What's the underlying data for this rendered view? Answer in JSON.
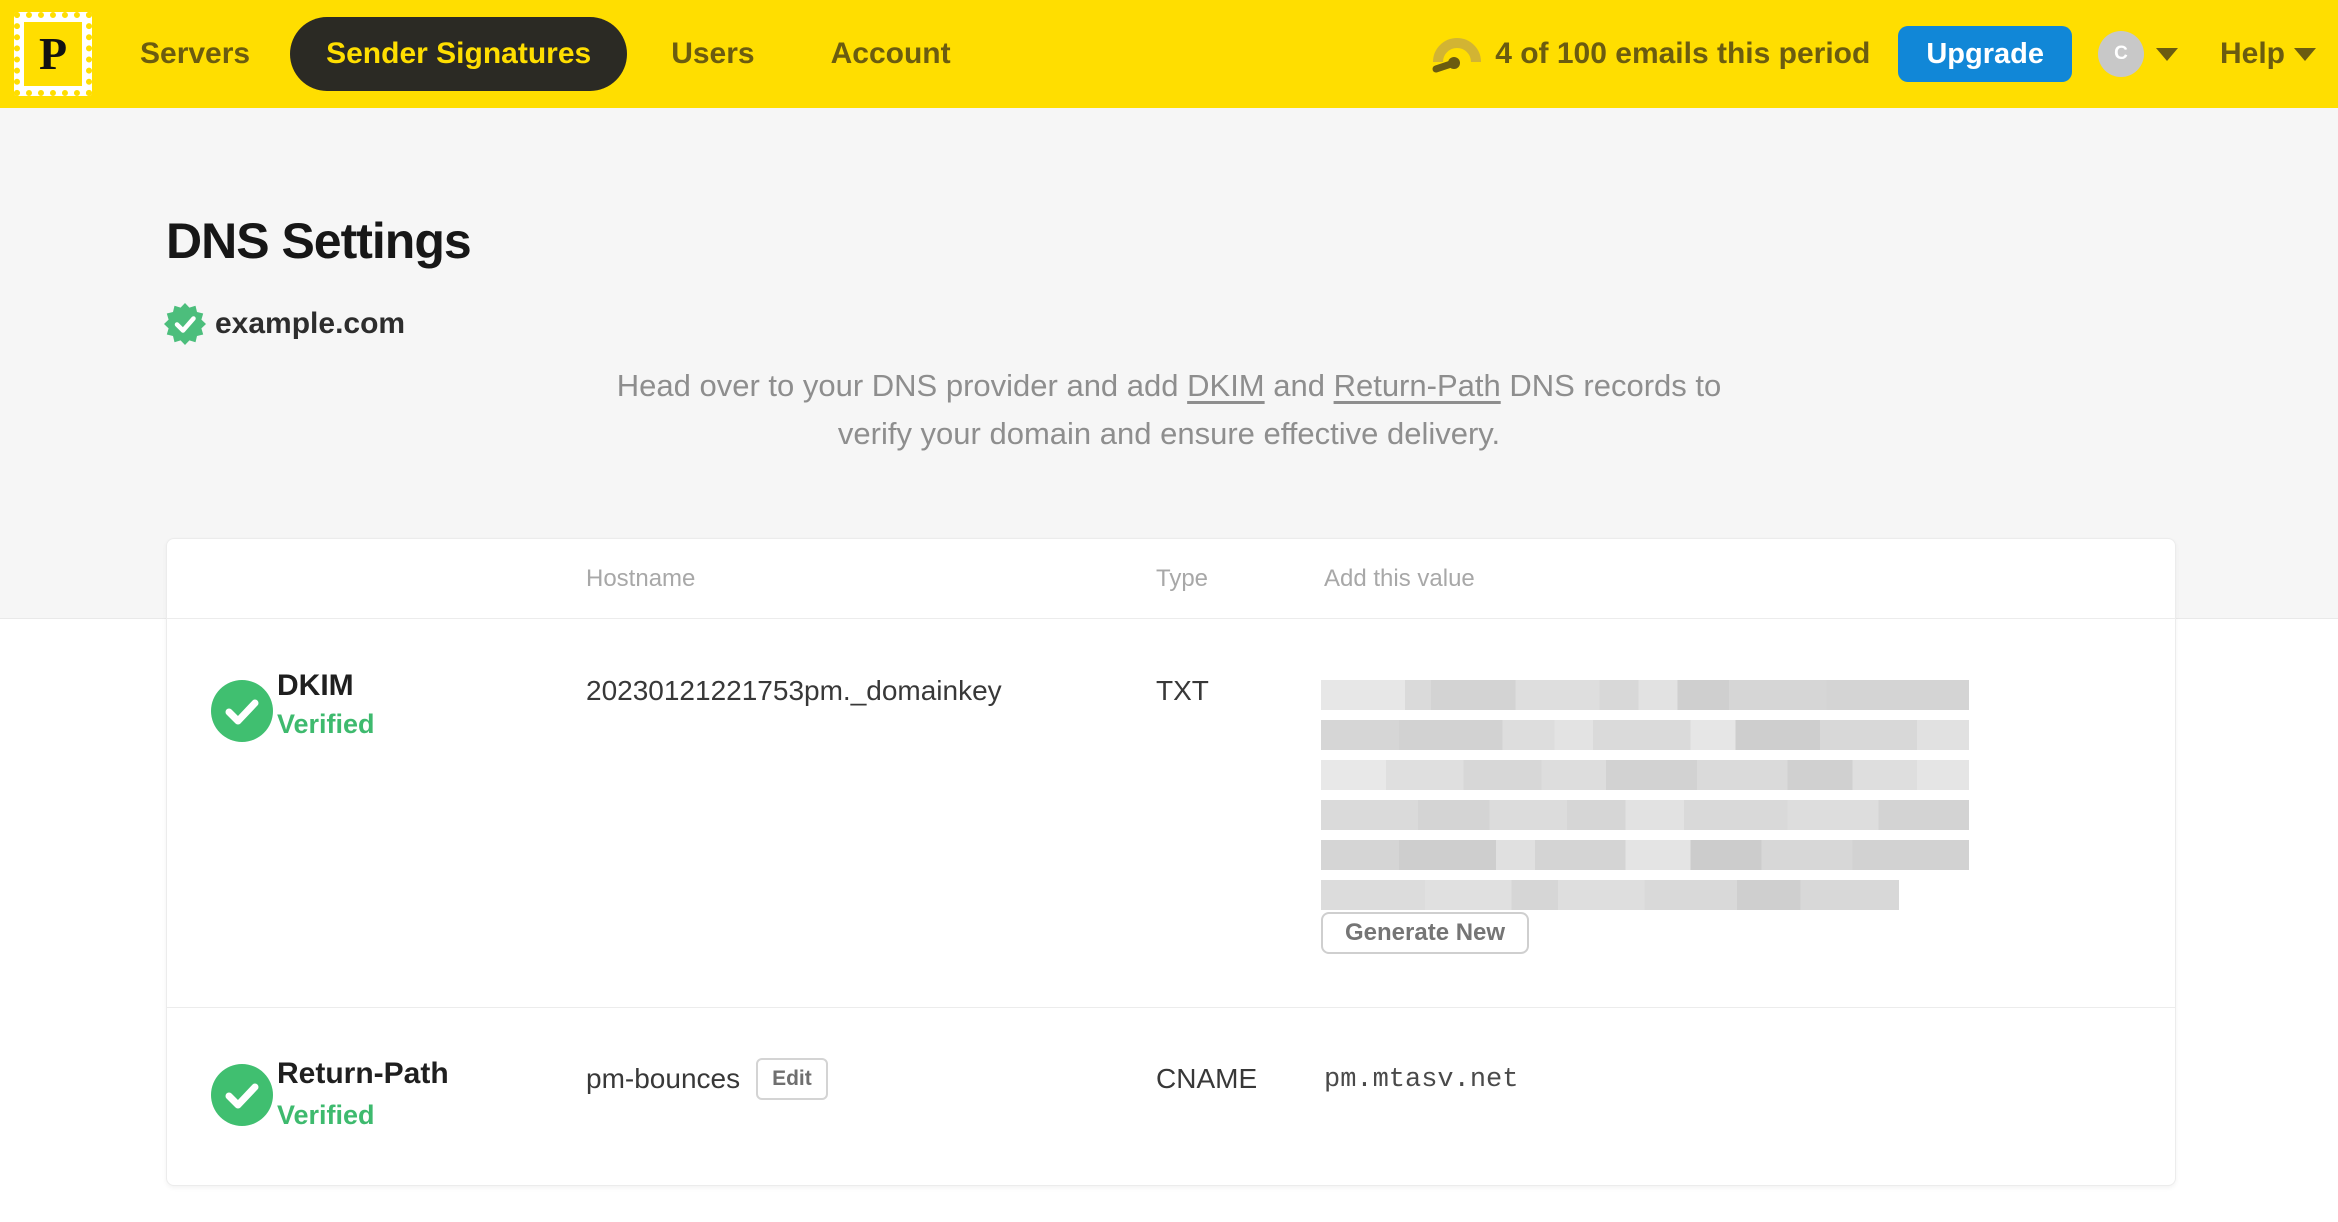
{
  "header": {
    "logo_letter": "P",
    "nav": [
      {
        "label": "Servers",
        "active": false
      },
      {
        "label": "Sender Signatures",
        "active": true
      },
      {
        "label": "Users",
        "active": false
      },
      {
        "label": "Account",
        "active": false
      }
    ],
    "usage_text": "4 of 100 emails this period",
    "upgrade_label": "Upgrade",
    "avatar_initial": "C",
    "help_label": "Help"
  },
  "page": {
    "title": "DNS Settings",
    "domain": "example.com",
    "description": {
      "part1": "Head over to your DNS provider and add ",
      "link_dkim": "DKIM",
      "part2": " and ",
      "link_return_path": "Return-Path",
      "part3": " DNS records to",
      "line2": "verify your domain and ensure effective delivery."
    }
  },
  "table": {
    "columns": {
      "hostname": "Hostname",
      "type": "Type",
      "value": "Add this value"
    },
    "rows": [
      {
        "name": "DKIM",
        "status": "Verified",
        "hostname": "20230121221753pm._domainkey",
        "type": "TXT",
        "value_redacted": true,
        "redacted_lines": 6,
        "action_label": "Generate New"
      },
      {
        "name": "Return-Path",
        "status": "Verified",
        "hostname": "pm-bounces",
        "edit_label": "Edit",
        "type": "CNAME",
        "value": "pm.mtasv.net"
      }
    ]
  },
  "icons": {
    "logo": "postmark-stamp-icon",
    "usage": "gauge-icon",
    "domain_badge": "verified-seal-icon",
    "row_status": "check-circle-icon",
    "menus": "caret-down-icon"
  },
  "colors": {
    "brand_yellow": "#FFDE00",
    "nav_text": "#6b5c10",
    "active_pill_bg": "#2b2a24",
    "upgrade_blue": "#1187d7",
    "verified_green": "#3eba6e",
    "page_band_gray": "#f6f6f6"
  }
}
